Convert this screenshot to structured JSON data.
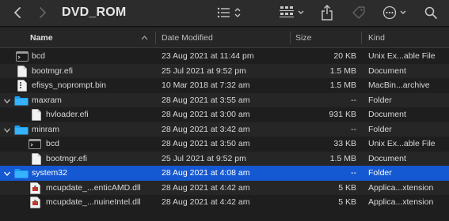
{
  "toolbar": {
    "title": "DVD_ROM"
  },
  "columns": {
    "name": "Name",
    "date": "Date Modified",
    "size": "Size",
    "kind": "Kind"
  },
  "rows": [
    {
      "name": "bcd",
      "date": "23 Aug 2021 at 11:44 pm",
      "size": "20 KB",
      "kind": "Unix Ex...able File"
    },
    {
      "name": "bootmgr.efi",
      "date": "25 Jul 2021 at 9:52 pm",
      "size": "1.5 MB",
      "kind": "Document"
    },
    {
      "name": "efisys_noprompt.bin",
      "date": "10 Mar 2018 at 7:32 am",
      "size": "1.5 MB",
      "kind": "MacBin...archive"
    },
    {
      "name": "maxram",
      "date": "28 Aug 2021 at 3:55 am",
      "size": "--",
      "kind": "Folder"
    },
    {
      "name": "hvloader.efi",
      "date": "28 Aug 2021 at 3:00 am",
      "size": "931 KB",
      "kind": "Document"
    },
    {
      "name": "minram",
      "date": "28 Aug 2021 at 3:42 am",
      "size": "--",
      "kind": "Folder"
    },
    {
      "name": "bcd",
      "date": "28 Aug 2021 at 3:50 am",
      "size": "33 KB",
      "kind": "Unix Ex...able File"
    },
    {
      "name": "bootmgr.efi",
      "date": "25 Jul 2021 at 9:52 pm",
      "size": "1.5 MB",
      "kind": "Document"
    },
    {
      "name": "system32",
      "date": "28 Aug 2021 at 4:08 am",
      "size": "--",
      "kind": "Folder"
    },
    {
      "name": "mcupdate_...enticAMD.dll",
      "date": "28 Aug 2021 at 4:42 am",
      "size": "5 KB",
      "kind": "Applica...xtension"
    },
    {
      "name": "mcupdate_...nuineIntel.dll",
      "date": "28 Aug 2021 at 4:42 am",
      "size": "5 KB",
      "kind": "Applica...xtension"
    }
  ]
}
